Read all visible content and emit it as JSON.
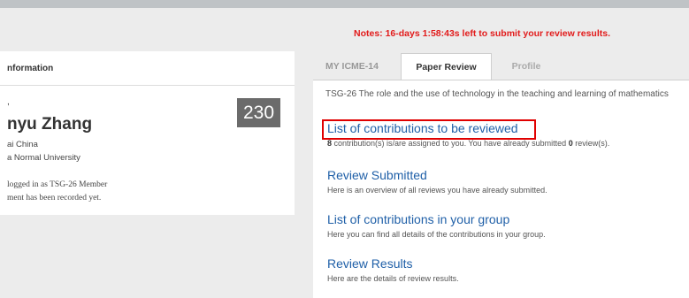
{
  "top_banner": "",
  "notes": "Notes: 16-days 1:58:43s left to submit your review results.",
  "left_panel": {
    "header": "nformation",
    "greeting": ",",
    "name": "nyu Zhang",
    "badge": "230",
    "city": "ai China",
    "university": "a Normal University",
    "login": "logged in as  TSG-26  Member",
    "note": "ment has been recorded yet."
  },
  "tabs": [
    {
      "label": "MY ICME-14",
      "active": false
    },
    {
      "label": "Paper Review",
      "active": true
    },
    {
      "label": "Profile",
      "active": false
    }
  ],
  "main": {
    "tsg_title": "TSG-26 The role and the use of technology in the teaching and learning of mathematics",
    "sections": [
      {
        "title": "List of contributions to be reviewed",
        "desc_count": "8",
        "desc_mid": " contribution(s) is/are assigned to you. You have already submitted ",
        "desc_reviews": "0",
        "desc_end": " review(s)."
      },
      {
        "title": "Review Submitted",
        "desc": "Here is an overview of all reviews you have already submitted."
      },
      {
        "title": "List of contributions in your group",
        "desc": "Here you can find all details of the contributions in your group."
      },
      {
        "title": "Review Results",
        "desc": "Here are the details of review results."
      }
    ]
  },
  "colors": {
    "notes": "#e21b1b",
    "link": "#2060a8",
    "highlight": "#e00000",
    "badge_bg": "#6b6b6b"
  }
}
